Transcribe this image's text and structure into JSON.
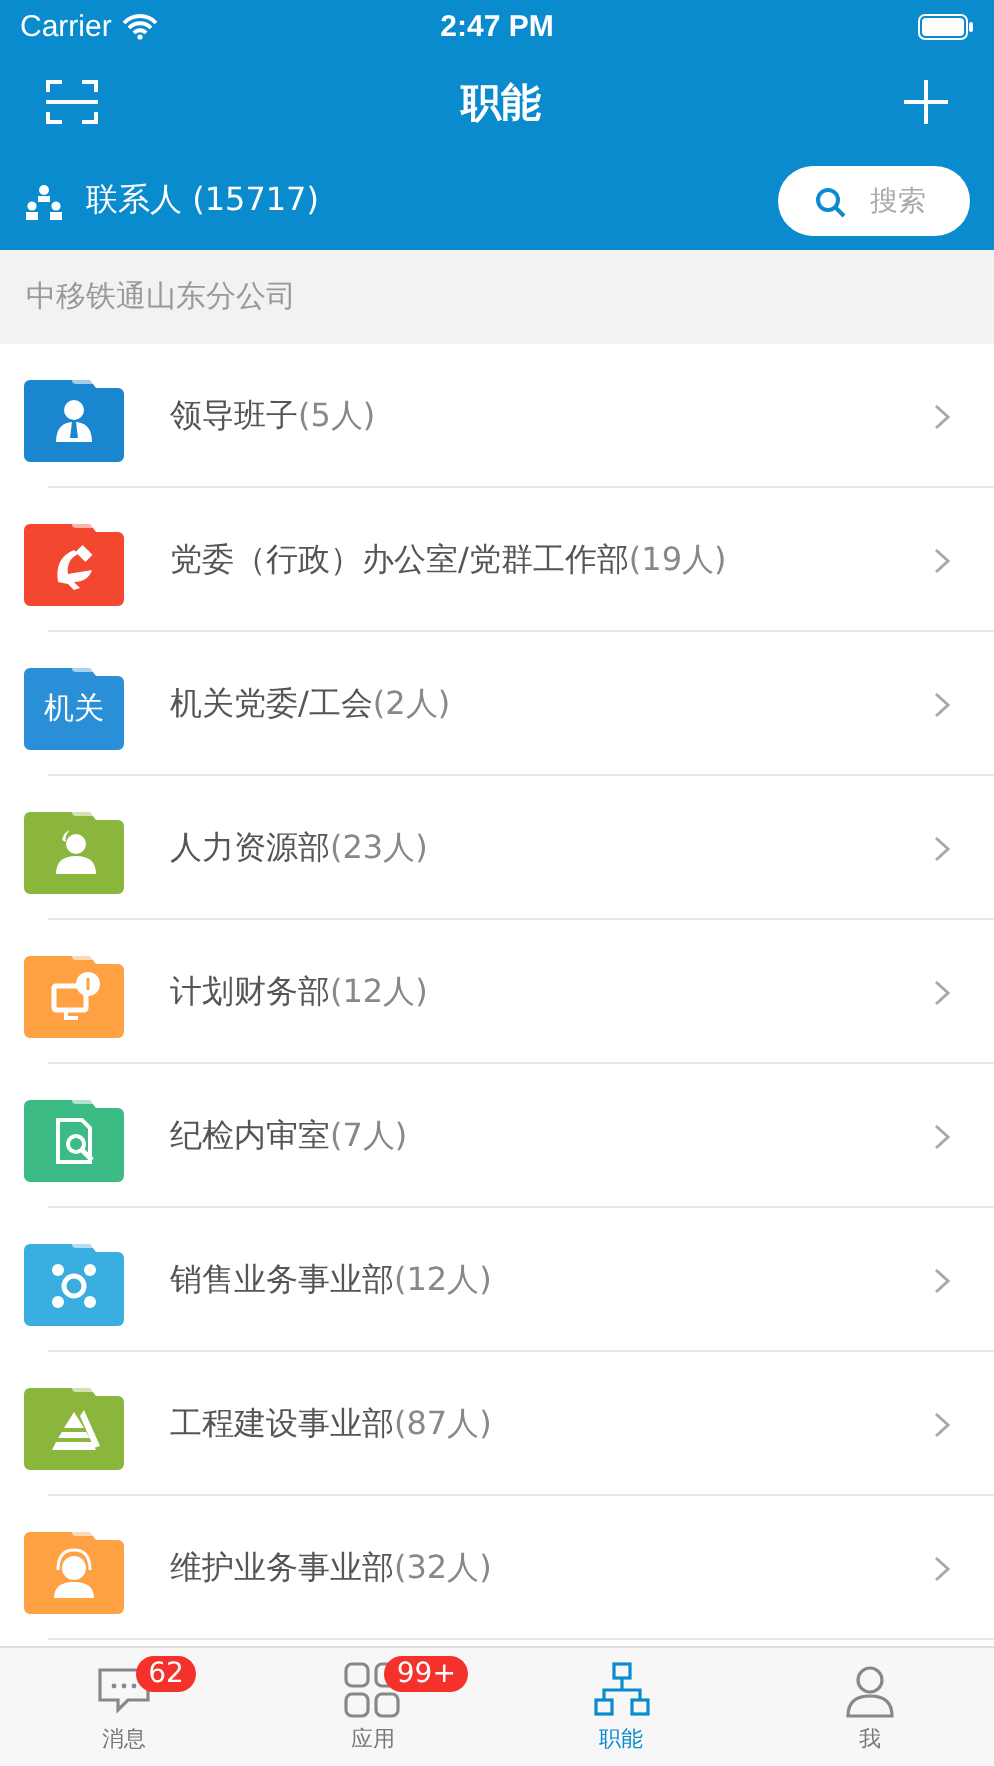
{
  "status_bar": {
    "carrier": "Carrier",
    "time": "2:47 PM"
  },
  "nav": {
    "title": "职能"
  },
  "contact_bar": {
    "label": "联系人 (15717)",
    "search": {
      "placeholder": "搜索"
    }
  },
  "section": {
    "title": "中移铁通山东分公司"
  },
  "departments": [
    {
      "name": "领导班子",
      "count": "(5人)",
      "color": "#1a86d0",
      "kind": "leader"
    },
    {
      "name": "党委（行政）办公室/党群工作部",
      "count": "(19人)",
      "color": "#f4472f",
      "kind": "party"
    },
    {
      "name": "机关党委/工会",
      "count": "(2人)",
      "color": "#2a8fd6",
      "kind": "text",
      "icon_text": "机关"
    },
    {
      "name": "人力资源部",
      "count": "(23人)",
      "color": "#8bb63e",
      "kind": "user"
    },
    {
      "name": "计划财务部",
      "count": "(12人)",
      "color": "#ffa043",
      "kind": "finance"
    },
    {
      "name": "纪检内审室",
      "count": "(7人)",
      "color": "#3dbb85",
      "kind": "audit"
    },
    {
      "name": "销售业务事业部",
      "count": "(12人)",
      "color": "#3aaee0",
      "kind": "network"
    },
    {
      "name": "工程建设事业部",
      "count": "(87人)",
      "color": "#8bb63e",
      "kind": "pyramid"
    },
    {
      "name": "维护业务事业部",
      "count": "(32人)",
      "color": "#ffa043",
      "kind": "headset"
    }
  ],
  "tab_bar": [
    {
      "label": "消息",
      "badge": "62",
      "kind": "chat",
      "selected": false
    },
    {
      "label": "应用",
      "badge": "99+",
      "kind": "apps",
      "selected": false
    },
    {
      "label": "职能",
      "kind": "org",
      "selected": true
    },
    {
      "label": "我",
      "kind": "me",
      "selected": false
    }
  ]
}
